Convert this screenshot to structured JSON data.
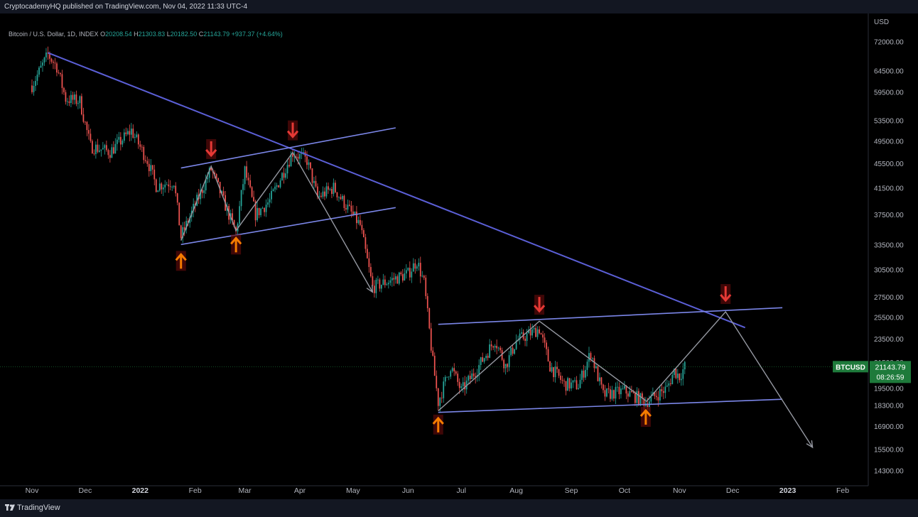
{
  "header": {
    "published": "CryptocademyHQ published on TradingView.com, Nov 04, 2022 11:33 UTC-4"
  },
  "legend": {
    "symbol": "Bitcoin / U.S. Dollar, 1D, INDEX",
    "open_label": "O",
    "open": "20208.54",
    "high_label": "H",
    "high": "21303.83",
    "low_label": "L",
    "low": "20182.50",
    "close_label": "C",
    "close": "21143.79",
    "change": "+937.37 (+4.64%)"
  },
  "footer": {
    "brand": "TradingView"
  },
  "colors": {
    "up": "#26a69a",
    "down": "#ef5350",
    "trendline": "#5b5fd6",
    "channel": "#7b86e8",
    "path": "#9598a1",
    "arrow_up": "#f57c00",
    "arrow_down": "#e53935",
    "price_badge": "#1e7a3b"
  },
  "chart_data": {
    "type": "candlestick",
    "symbol": "BTCUSD",
    "interval": "1D",
    "currency": "USD",
    "y_axis_scale": "log",
    "ylim": [
      13500,
      80000
    ],
    "y_ticks": [
      "72000.00",
      "64500.00",
      "59500.00",
      "53500.00",
      "49500.00",
      "45500.00",
      "41500.00",
      "37500.00",
      "33500.00",
      "30500.00",
      "27500.00",
      "25500.00",
      "23500.00",
      "21500.00",
      "19500.00",
      "18300.00",
      "16900.00",
      "15500.00",
      "14300.00"
    ],
    "x_ticks": [
      "Nov",
      "Dec",
      "2022",
      "Feb",
      "Mar",
      "Apr",
      "May",
      "Jun",
      "Jul",
      "Aug",
      "Sep",
      "Oct",
      "Nov",
      "Dec",
      "2023",
      "Feb"
    ],
    "last_price": "21143.79",
    "last_price_label": "BTCUSD",
    "countdown": "08:26:59",
    "price_path": [
      [
        "2021-11-01",
        61000
      ],
      [
        "2021-11-10",
        68500
      ],
      [
        "2021-11-15",
        65500
      ],
      [
        "2021-11-20",
        58000
      ],
      [
        "2021-11-28",
        57500
      ],
      [
        "2021-12-04",
        48500
      ],
      [
        "2021-12-15",
        47500
      ],
      [
        "2021-12-27",
        51500
      ],
      [
        "2022-01-05",
        46000
      ],
      [
        "2022-01-10",
        41800
      ],
      [
        "2022-01-20",
        42500
      ],
      [
        "2022-01-24",
        34500
      ],
      [
        "2022-02-10",
        44500
      ],
      [
        "2022-02-24",
        35000
      ],
      [
        "2022-03-01",
        44300
      ],
      [
        "2022-03-07",
        37500
      ],
      [
        "2022-03-15",
        39500
      ],
      [
        "2022-03-28",
        47400
      ],
      [
        "2022-04-05",
        46000
      ],
      [
        "2022-04-11",
        40000
      ],
      [
        "2022-04-20",
        41500
      ],
      [
        "2022-04-30",
        37700
      ],
      [
        "2022-05-05",
        36000
      ],
      [
        "2022-05-12",
        28500
      ],
      [
        "2022-05-25",
        29500
      ],
      [
        "2022-06-01",
        30000
      ],
      [
        "2022-06-06",
        31500
      ],
      [
        "2022-06-10",
        29000
      ],
      [
        "2022-06-15",
        21500
      ],
      [
        "2022-06-18",
        18500
      ],
      [
        "2022-06-25",
        21200
      ],
      [
        "2022-07-01",
        19300
      ],
      [
        "2022-07-10",
        21000
      ],
      [
        "2022-07-20",
        23400
      ],
      [
        "2022-07-26",
        21200
      ],
      [
        "2022-08-01",
        23300
      ],
      [
        "2022-08-14",
        24400
      ],
      [
        "2022-08-20",
        21200
      ],
      [
        "2022-08-28",
        19800
      ],
      [
        "2022-09-05",
        19700
      ],
      [
        "2022-09-12",
        22300
      ],
      [
        "2022-09-19",
        19000
      ],
      [
        "2022-10-01",
        19300
      ],
      [
        "2022-10-13",
        18500
      ],
      [
        "2022-10-25",
        19500
      ],
      [
        "2022-10-29",
        20800
      ],
      [
        "2022-11-01",
        20400
      ],
      [
        "2022-11-04",
        21143.79
      ]
    ],
    "annotations": {
      "descending_trendline": [
        [
          "2021-11-10",
          69000
        ],
        [
          "2022-12-08",
          24500
        ]
      ],
      "rising_channel_upper": [
        [
          "2022-01-24",
          44700
        ],
        [
          "2022-05-25",
          52000
        ]
      ],
      "rising_channel_lower": [
        [
          "2022-01-24",
          33500
        ],
        [
          "2022-05-25",
          38500
        ]
      ],
      "range_upper": [
        [
          "2022-06-18",
          24800
        ],
        [
          "2022-12-29",
          26400
        ]
      ],
      "range_lower": [
        [
          "2022-06-18",
          17800
        ],
        [
          "2022-12-29",
          18700
        ]
      ],
      "projection": [
        [
          "2022-10-13",
          18500
        ],
        [
          "2022-11-27",
          26000
        ],
        [
          "2023-01-15",
          15600
        ]
      ],
      "down_arrows": [
        [
          "2022-02-10",
          48000
        ],
        [
          "2022-03-28",
          51500
        ],
        [
          "2022-08-14",
          26700
        ],
        [
          "2022-11-27",
          27800
        ]
      ],
      "up_arrows": [
        [
          "2022-01-24",
          31500
        ],
        [
          "2022-02-24",
          33500
        ],
        [
          "2022-06-18",
          17000
        ],
        [
          "2022-10-13",
          17500
        ]
      ]
    }
  }
}
